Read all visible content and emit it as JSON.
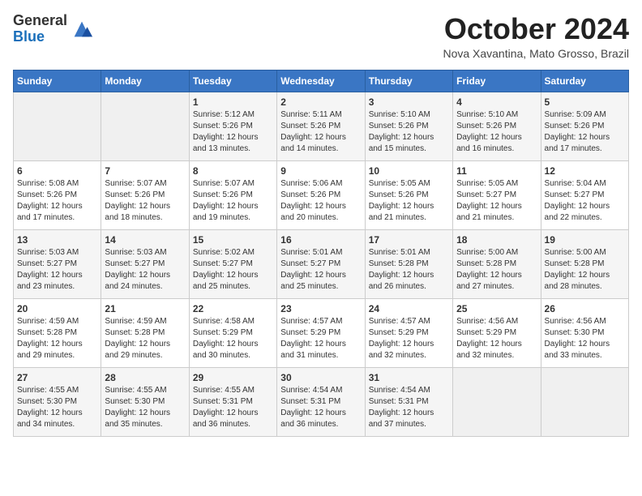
{
  "logo": {
    "general": "General",
    "blue": "Blue"
  },
  "title": {
    "month": "October 2024",
    "location": "Nova Xavantina, Mato Grosso, Brazil"
  },
  "weekdays": [
    "Sunday",
    "Monday",
    "Tuesday",
    "Wednesday",
    "Thursday",
    "Friday",
    "Saturday"
  ],
  "weeks": [
    [
      {
        "day": "",
        "empty": true
      },
      {
        "day": "",
        "empty": true
      },
      {
        "day": "1",
        "sunrise": "5:12 AM",
        "sunset": "5:26 PM",
        "daylight": "12 hours and 13 minutes."
      },
      {
        "day": "2",
        "sunrise": "5:11 AM",
        "sunset": "5:26 PM",
        "daylight": "12 hours and 14 minutes."
      },
      {
        "day": "3",
        "sunrise": "5:10 AM",
        "sunset": "5:26 PM",
        "daylight": "12 hours and 15 minutes."
      },
      {
        "day": "4",
        "sunrise": "5:10 AM",
        "sunset": "5:26 PM",
        "daylight": "12 hours and 16 minutes."
      },
      {
        "day": "5",
        "sunrise": "5:09 AM",
        "sunset": "5:26 PM",
        "daylight": "12 hours and 17 minutes."
      }
    ],
    [
      {
        "day": "6",
        "sunrise": "5:08 AM",
        "sunset": "5:26 PM",
        "daylight": "12 hours and 17 minutes."
      },
      {
        "day": "7",
        "sunrise": "5:07 AM",
        "sunset": "5:26 PM",
        "daylight": "12 hours and 18 minutes."
      },
      {
        "day": "8",
        "sunrise": "5:07 AM",
        "sunset": "5:26 PM",
        "daylight": "12 hours and 19 minutes."
      },
      {
        "day": "9",
        "sunrise": "5:06 AM",
        "sunset": "5:26 PM",
        "daylight": "12 hours and 20 minutes."
      },
      {
        "day": "10",
        "sunrise": "5:05 AM",
        "sunset": "5:26 PM",
        "daylight": "12 hours and 21 minutes."
      },
      {
        "day": "11",
        "sunrise": "5:05 AM",
        "sunset": "5:27 PM",
        "daylight": "12 hours and 21 minutes."
      },
      {
        "day": "12",
        "sunrise": "5:04 AM",
        "sunset": "5:27 PM",
        "daylight": "12 hours and 22 minutes."
      }
    ],
    [
      {
        "day": "13",
        "sunrise": "5:03 AM",
        "sunset": "5:27 PM",
        "daylight": "12 hours and 23 minutes."
      },
      {
        "day": "14",
        "sunrise": "5:03 AM",
        "sunset": "5:27 PM",
        "daylight": "12 hours and 24 minutes."
      },
      {
        "day": "15",
        "sunrise": "5:02 AM",
        "sunset": "5:27 PM",
        "daylight": "12 hours and 25 minutes."
      },
      {
        "day": "16",
        "sunrise": "5:01 AM",
        "sunset": "5:27 PM",
        "daylight": "12 hours and 25 minutes."
      },
      {
        "day": "17",
        "sunrise": "5:01 AM",
        "sunset": "5:28 PM",
        "daylight": "12 hours and 26 minutes."
      },
      {
        "day": "18",
        "sunrise": "5:00 AM",
        "sunset": "5:28 PM",
        "daylight": "12 hours and 27 minutes."
      },
      {
        "day": "19",
        "sunrise": "5:00 AM",
        "sunset": "5:28 PM",
        "daylight": "12 hours and 28 minutes."
      }
    ],
    [
      {
        "day": "20",
        "sunrise": "4:59 AM",
        "sunset": "5:28 PM",
        "daylight": "12 hours and 29 minutes."
      },
      {
        "day": "21",
        "sunrise": "4:59 AM",
        "sunset": "5:28 PM",
        "daylight": "12 hours and 29 minutes."
      },
      {
        "day": "22",
        "sunrise": "4:58 AM",
        "sunset": "5:29 PM",
        "daylight": "12 hours and 30 minutes."
      },
      {
        "day": "23",
        "sunrise": "4:57 AM",
        "sunset": "5:29 PM",
        "daylight": "12 hours and 31 minutes."
      },
      {
        "day": "24",
        "sunrise": "4:57 AM",
        "sunset": "5:29 PM",
        "daylight": "12 hours and 32 minutes."
      },
      {
        "day": "25",
        "sunrise": "4:56 AM",
        "sunset": "5:29 PM",
        "daylight": "12 hours and 32 minutes."
      },
      {
        "day": "26",
        "sunrise": "4:56 AM",
        "sunset": "5:30 PM",
        "daylight": "12 hours and 33 minutes."
      }
    ],
    [
      {
        "day": "27",
        "sunrise": "4:55 AM",
        "sunset": "5:30 PM",
        "daylight": "12 hours and 34 minutes."
      },
      {
        "day": "28",
        "sunrise": "4:55 AM",
        "sunset": "5:30 PM",
        "daylight": "12 hours and 35 minutes."
      },
      {
        "day": "29",
        "sunrise": "4:55 AM",
        "sunset": "5:31 PM",
        "daylight": "12 hours and 36 minutes."
      },
      {
        "day": "30",
        "sunrise": "4:54 AM",
        "sunset": "5:31 PM",
        "daylight": "12 hours and 36 minutes."
      },
      {
        "day": "31",
        "sunrise": "4:54 AM",
        "sunset": "5:31 PM",
        "daylight": "12 hours and 37 minutes."
      },
      {
        "day": "",
        "empty": true
      },
      {
        "day": "",
        "empty": true
      }
    ]
  ],
  "labels": {
    "sunrise": "Sunrise:",
    "sunset": "Sunset:",
    "daylight": "Daylight:"
  }
}
